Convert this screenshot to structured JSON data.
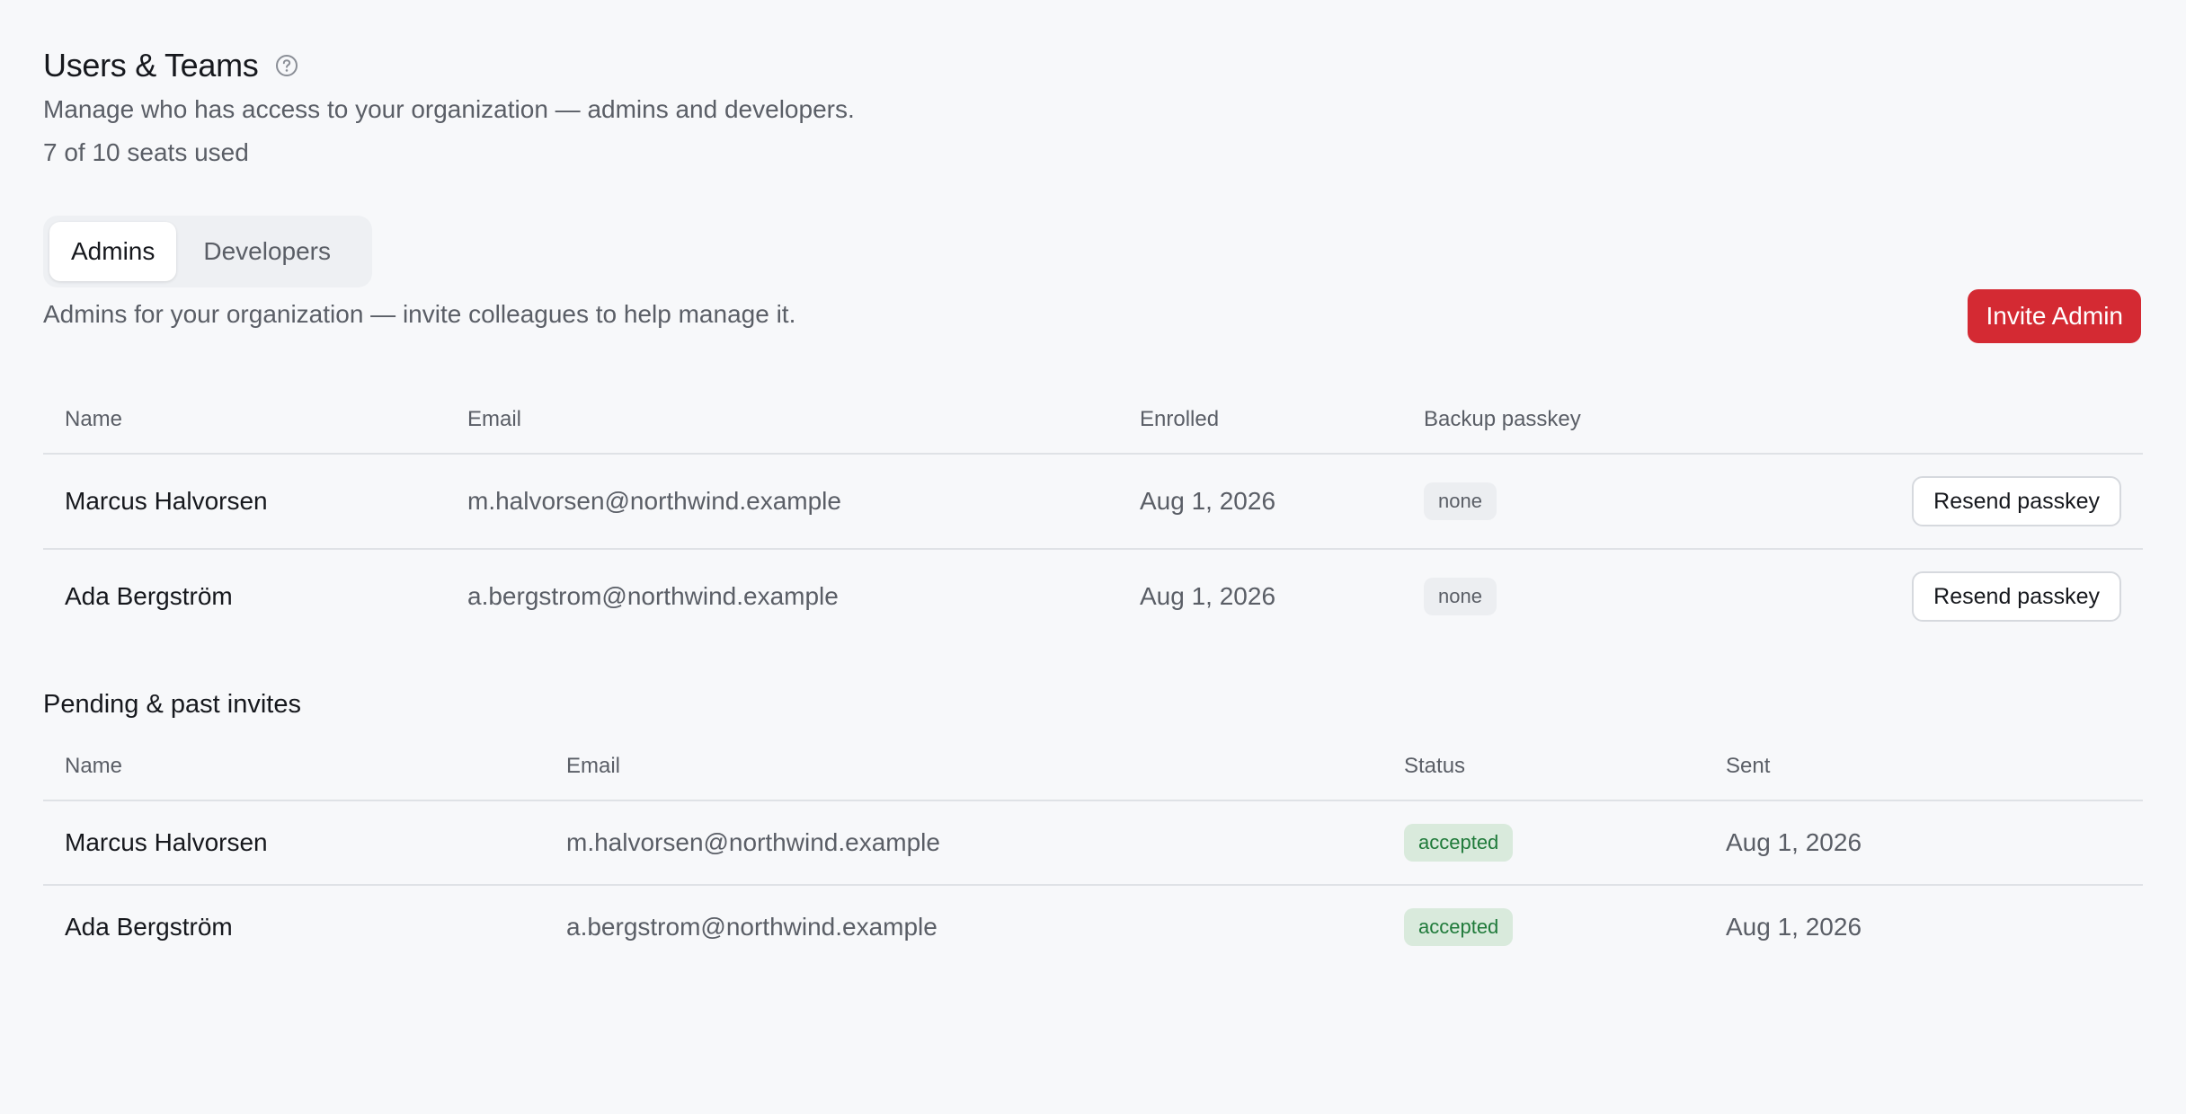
{
  "header": {
    "title": "Users & Teams",
    "help_icon": "question-circle-icon",
    "subtitle": "Manage who has access to your organization — admins and developers.",
    "seats": "7 of 10 seats used"
  },
  "tabs": [
    {
      "label": "Admins",
      "active": true
    },
    {
      "label": "Developers",
      "active": false
    }
  ],
  "admins_section": {
    "description": "Admins for your organization — invite colleagues to help manage it.",
    "invite_button": "Invite Admin",
    "columns": [
      "Name",
      "Email",
      "Enrolled",
      "Backup passkey"
    ],
    "rows": [
      {
        "name": "Marcus Halvorsen",
        "email": "m.halvorsen@northwind.example",
        "enrolled": "Aug 1, 2026",
        "backup": "none",
        "action": "Resend passkey"
      },
      {
        "name": "Ada Bergström",
        "email": "a.bergstrom@northwind.example",
        "enrolled": "Aug 1, 2026",
        "backup": "none",
        "action": "Resend passkey"
      }
    ]
  },
  "invites_section": {
    "title": "Pending & past invites",
    "columns": [
      "Name",
      "Email",
      "Status",
      "Sent"
    ],
    "rows": [
      {
        "name": "Marcus Halvorsen",
        "email": "m.halvorsen@northwind.example",
        "status": "accepted",
        "sent": "Aug 1, 2026"
      },
      {
        "name": "Ada Bergström",
        "email": "a.bergstrom@northwind.example",
        "status": "accepted",
        "sent": "Aug 1, 2026"
      }
    ]
  },
  "colors": {
    "accent": "#d42a33",
    "background": "#f7f8fa",
    "accepted_bg": "#d9eadc",
    "accepted_text": "#1f7a3a"
  }
}
